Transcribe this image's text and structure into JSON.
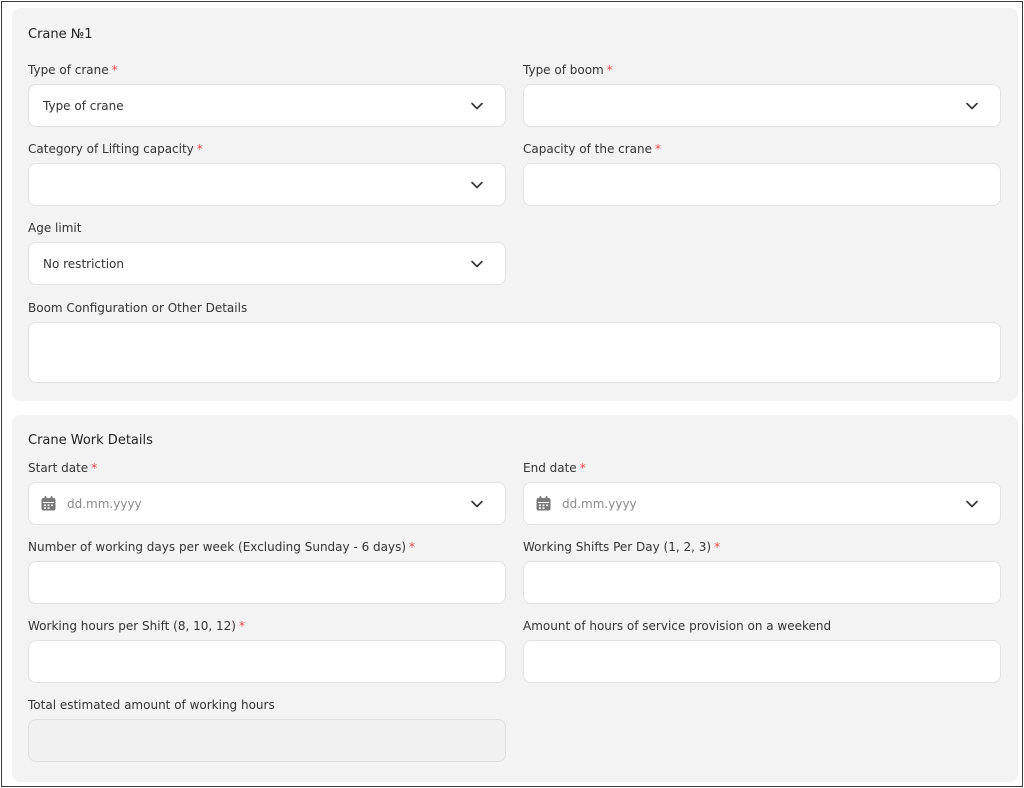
{
  "crane_section": {
    "title": "Crane №1",
    "type_of_crane": {
      "label": "Type of crane",
      "required": "*",
      "value": "Type of crane",
      "icon": "chevron-down-icon"
    },
    "type_of_boom": {
      "label": "Type of boom",
      "required": "*",
      "value": "",
      "icon": "chevron-down-icon"
    },
    "lifting_category": {
      "label": "Category of Lifting capacity",
      "required": "*",
      "value": "",
      "icon": "chevron-down-icon"
    },
    "crane_capacity": {
      "label": "Capacity of the crane",
      "required": "*",
      "value": ""
    },
    "age_limit": {
      "label": "Age limit",
      "value": "No restriction",
      "icon": "chevron-down-icon"
    },
    "boom_details": {
      "label": "Boom Configuration or Other Details",
      "value": ""
    }
  },
  "work_section": {
    "title": "Crane Work Details",
    "start_date": {
      "label": "Start date",
      "required": "*",
      "placeholder": "dd.mm.yyyy",
      "icon": "calendar-icon"
    },
    "end_date": {
      "label": "End date",
      "required": "*",
      "placeholder": "dd.mm.yyyy",
      "icon": "calendar-icon"
    },
    "working_days": {
      "label": "Number of working days per week (Excluding Sunday - 6 days)",
      "required": "*",
      "value": ""
    },
    "working_shifts": {
      "label": "Working Shifts Per Day (1, 2, 3)",
      "required": "*",
      "value": ""
    },
    "hours_per_shift": {
      "label": "Working hours per Shift (8, 10, 12)",
      "required": "*",
      "value": ""
    },
    "weekend_hours": {
      "label": "Amount of hours of service provision on a weekend",
      "value": ""
    },
    "total_hours": {
      "label": "Total estimated amount of working hours",
      "value": ""
    }
  },
  "colors": {
    "card_bg": "#f3f3f3",
    "required": "#e5484d",
    "field_border": "#e2e2e2",
    "placeholder": "#8a8a8a"
  }
}
